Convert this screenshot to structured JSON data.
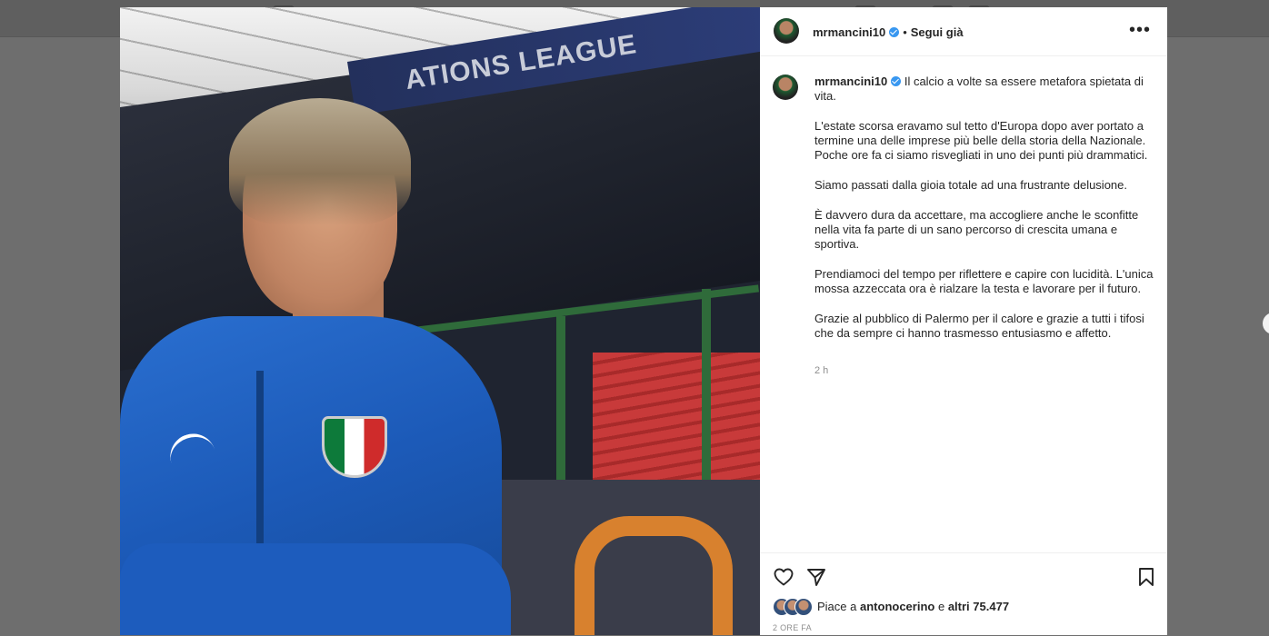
{
  "post": {
    "author": "mrmancini10",
    "follow_label": "Segui già",
    "separator": "•",
    "more_label": "•••"
  },
  "photo": {
    "banner_text": "ATIONS LEAGUE"
  },
  "caption": {
    "author": "mrmancini10",
    "paragraphs": [
      "Il calcio a volte sa essere metafora spietata di vita.",
      "L'estate scorsa eravamo sul tetto d'Europa dopo aver portato a termine una delle imprese più belle della storia della Nazionale. Poche ore fa ci siamo risvegliati in uno dei punti più drammatici.",
      "Siamo passati dalla gioia totale ad una frustrante delusione.",
      "È davvero dura da accettare, ma accogliere anche le sconfitte nella vita fa parte di un sano percorso di crescita umana e sportiva.",
      "Prendiamoci del tempo per riflettere e capire con lucidità. L'unica mossa azzeccata ora è rialzare la testa e lavorare per il futuro.",
      "Grazie al pubblico di Palermo per il calore e grazie a tutti i tifosi che da sempre ci hanno trasmesso entusiasmo e affetto."
    ],
    "time": "2 h"
  },
  "likes": {
    "prefix": "Piace a",
    "user": "antonocerino",
    "joiner": "e",
    "others": "altri 75.477"
  },
  "timestamp": "2 ORE FA",
  "icons": [
    "heart-icon",
    "share-icon",
    "bookmark-icon",
    "more-options-icon",
    "verified-icon"
  ]
}
